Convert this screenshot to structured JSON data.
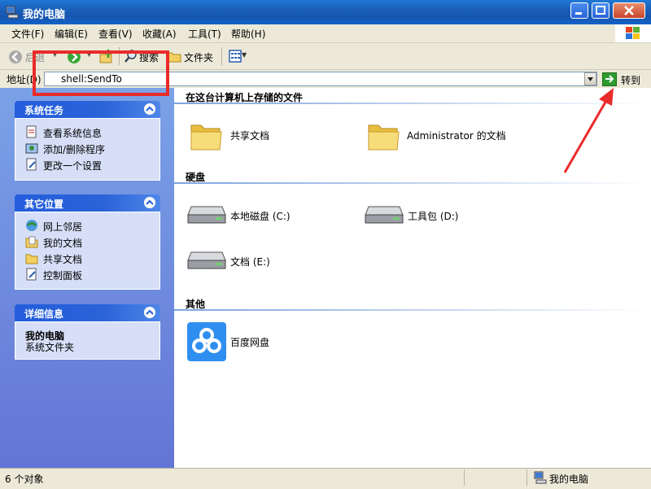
{
  "window": {
    "title": "我的电脑"
  },
  "menu": [
    "文件(F)",
    "编辑(E)",
    "查看(V)",
    "收藏(A)",
    "工具(T)",
    "帮助(H)"
  ],
  "toolbar": {
    "back_label": "后退",
    "search_label": "搜索",
    "folders_label": "文件夹"
  },
  "address": {
    "label": "地址(D)",
    "value": "shell:SendTo",
    "go_label": "转到"
  },
  "left_panels": {
    "system_tasks": {
      "title": "系统任务",
      "items": [
        "查看系统信息",
        "添加/删除程序",
        "更改一个设置"
      ]
    },
    "other_places": {
      "title": "其它位置",
      "items": [
        "网上邻居",
        "我的文档",
        "共享文档",
        "控制面板"
      ]
    },
    "details": {
      "title": "详细信息",
      "name": "我的电脑",
      "desc": "系统文件夹"
    }
  },
  "sections": {
    "stored_files": {
      "title": "在这台计算机上存储的文件",
      "items": [
        "共享文档",
        "Administrator 的文档"
      ]
    },
    "hard_drives": {
      "title": "硬盘",
      "items": [
        "本地磁盘 (C:)",
        "工具包 (D:)",
        "文档 (E:)"
      ]
    },
    "other": {
      "title": "其他",
      "items": [
        "百度网盘"
      ]
    }
  },
  "status": {
    "count": "6 个对象",
    "location": "我的电脑"
  },
  "colors": {
    "annotation": "#ea2b2b",
    "titlebar": "#1a5fb8",
    "panel_head": "#245edc"
  }
}
